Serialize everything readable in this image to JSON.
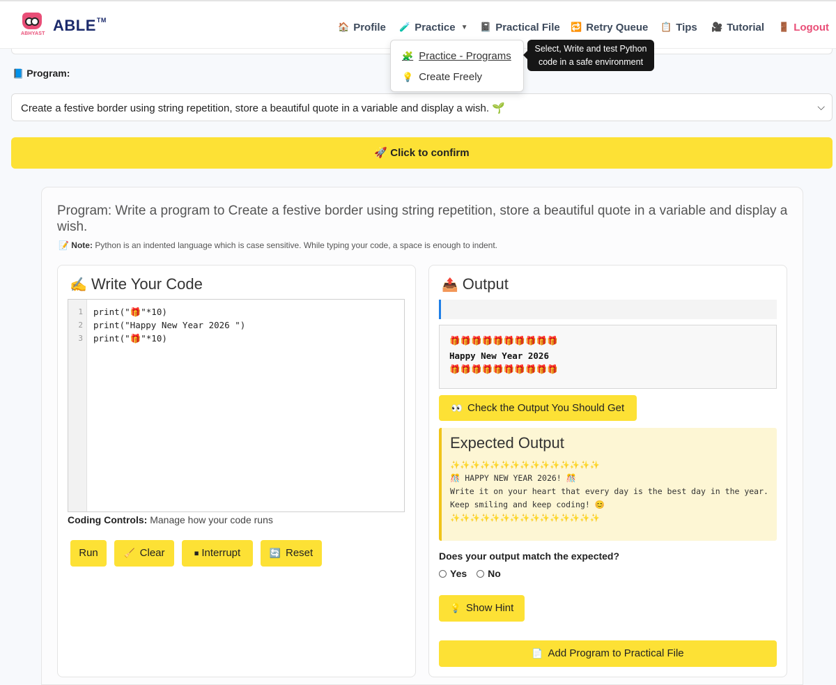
{
  "brand": {
    "logo_sub": "ABHYAST",
    "name": "ABLE",
    "tm": "TM"
  },
  "nav": [
    {
      "icon": "🏠",
      "label": "Profile"
    },
    {
      "icon": "🧪",
      "label": "Practice"
    },
    {
      "icon": "📓",
      "label": "Practical File"
    },
    {
      "icon": "🔁",
      "label": "Retry Queue"
    },
    {
      "icon": "📋",
      "label": "Tips"
    },
    {
      "icon": "🎥",
      "label": "Tutorial"
    },
    {
      "icon": "🚪",
      "label": "Logout"
    }
  ],
  "dropdown": {
    "items": [
      {
        "icon": "🧩",
        "label": "Practice - Programs"
      },
      {
        "icon": "💡",
        "label": "Create Freely"
      }
    ],
    "tooltip": "Select, Write and test Python code in a safe environment"
  },
  "program": {
    "label_icon": "📘",
    "label": "Program:",
    "selected": "Create a festive border using string repetition, store a beautiful quote in a variable and display a wish. 🌱",
    "confirm_icon": "🚀",
    "confirm_label": "Click to confirm"
  },
  "card": {
    "title": "Program: Write a program to Create a festive border using string repetition, store a beautiful quote in a variable and display a wish.",
    "note_icon": "📝",
    "note_label": "Note:",
    "note_text": "Python is an indented language which is case sensitive. While typing your code, a space is enough to indent."
  },
  "editor": {
    "title_icon": "✍️",
    "title": "Write Your Code",
    "line_numbers": [
      "1",
      "2",
      "3"
    ],
    "lines": [
      "print(\"🎁\"*10)",
      "print(\"Happy New Year 2026 \")",
      "print(\"🎁\"*10)"
    ]
  },
  "controls": {
    "label": "Coding Controls:",
    "text": "Manage how your code runs",
    "run": "Run",
    "clear_icon": "🧹",
    "clear": "Clear",
    "interrupt_icon": "⏹",
    "interrupt": "Interrupt",
    "reset_icon": "🔄",
    "reset": "Reset"
  },
  "output": {
    "title_icon": "📤",
    "title": "Output",
    "lines": [
      "🎁🎁🎁🎁🎁🎁🎁🎁🎁🎁",
      "Happy New Year 2026",
      "🎁🎁🎁🎁🎁🎁🎁🎁🎁🎁"
    ],
    "check_icon": "👀",
    "check_label": "Check the Output You Should Get"
  },
  "expected": {
    "title": "Expected Output",
    "lines": [
      "✨✨✨✨✨✨✨✨✨✨✨✨✨✨✨",
      "🎊 HAPPY NEW YEAR 2026! 🎊",
      "Write it on your heart that every day is the best day in the year.",
      "Keep smiling and keep coding! 😊",
      "✨✨✨✨✨✨✨✨✨✨✨✨✨✨✨"
    ]
  },
  "match": {
    "question": "Does your output match the expected?",
    "yes": "Yes",
    "no": "No",
    "hint_icon": "💡",
    "hint": "Show Hint",
    "add_icon": "📄",
    "add_label": "Add Program to Practical File"
  }
}
